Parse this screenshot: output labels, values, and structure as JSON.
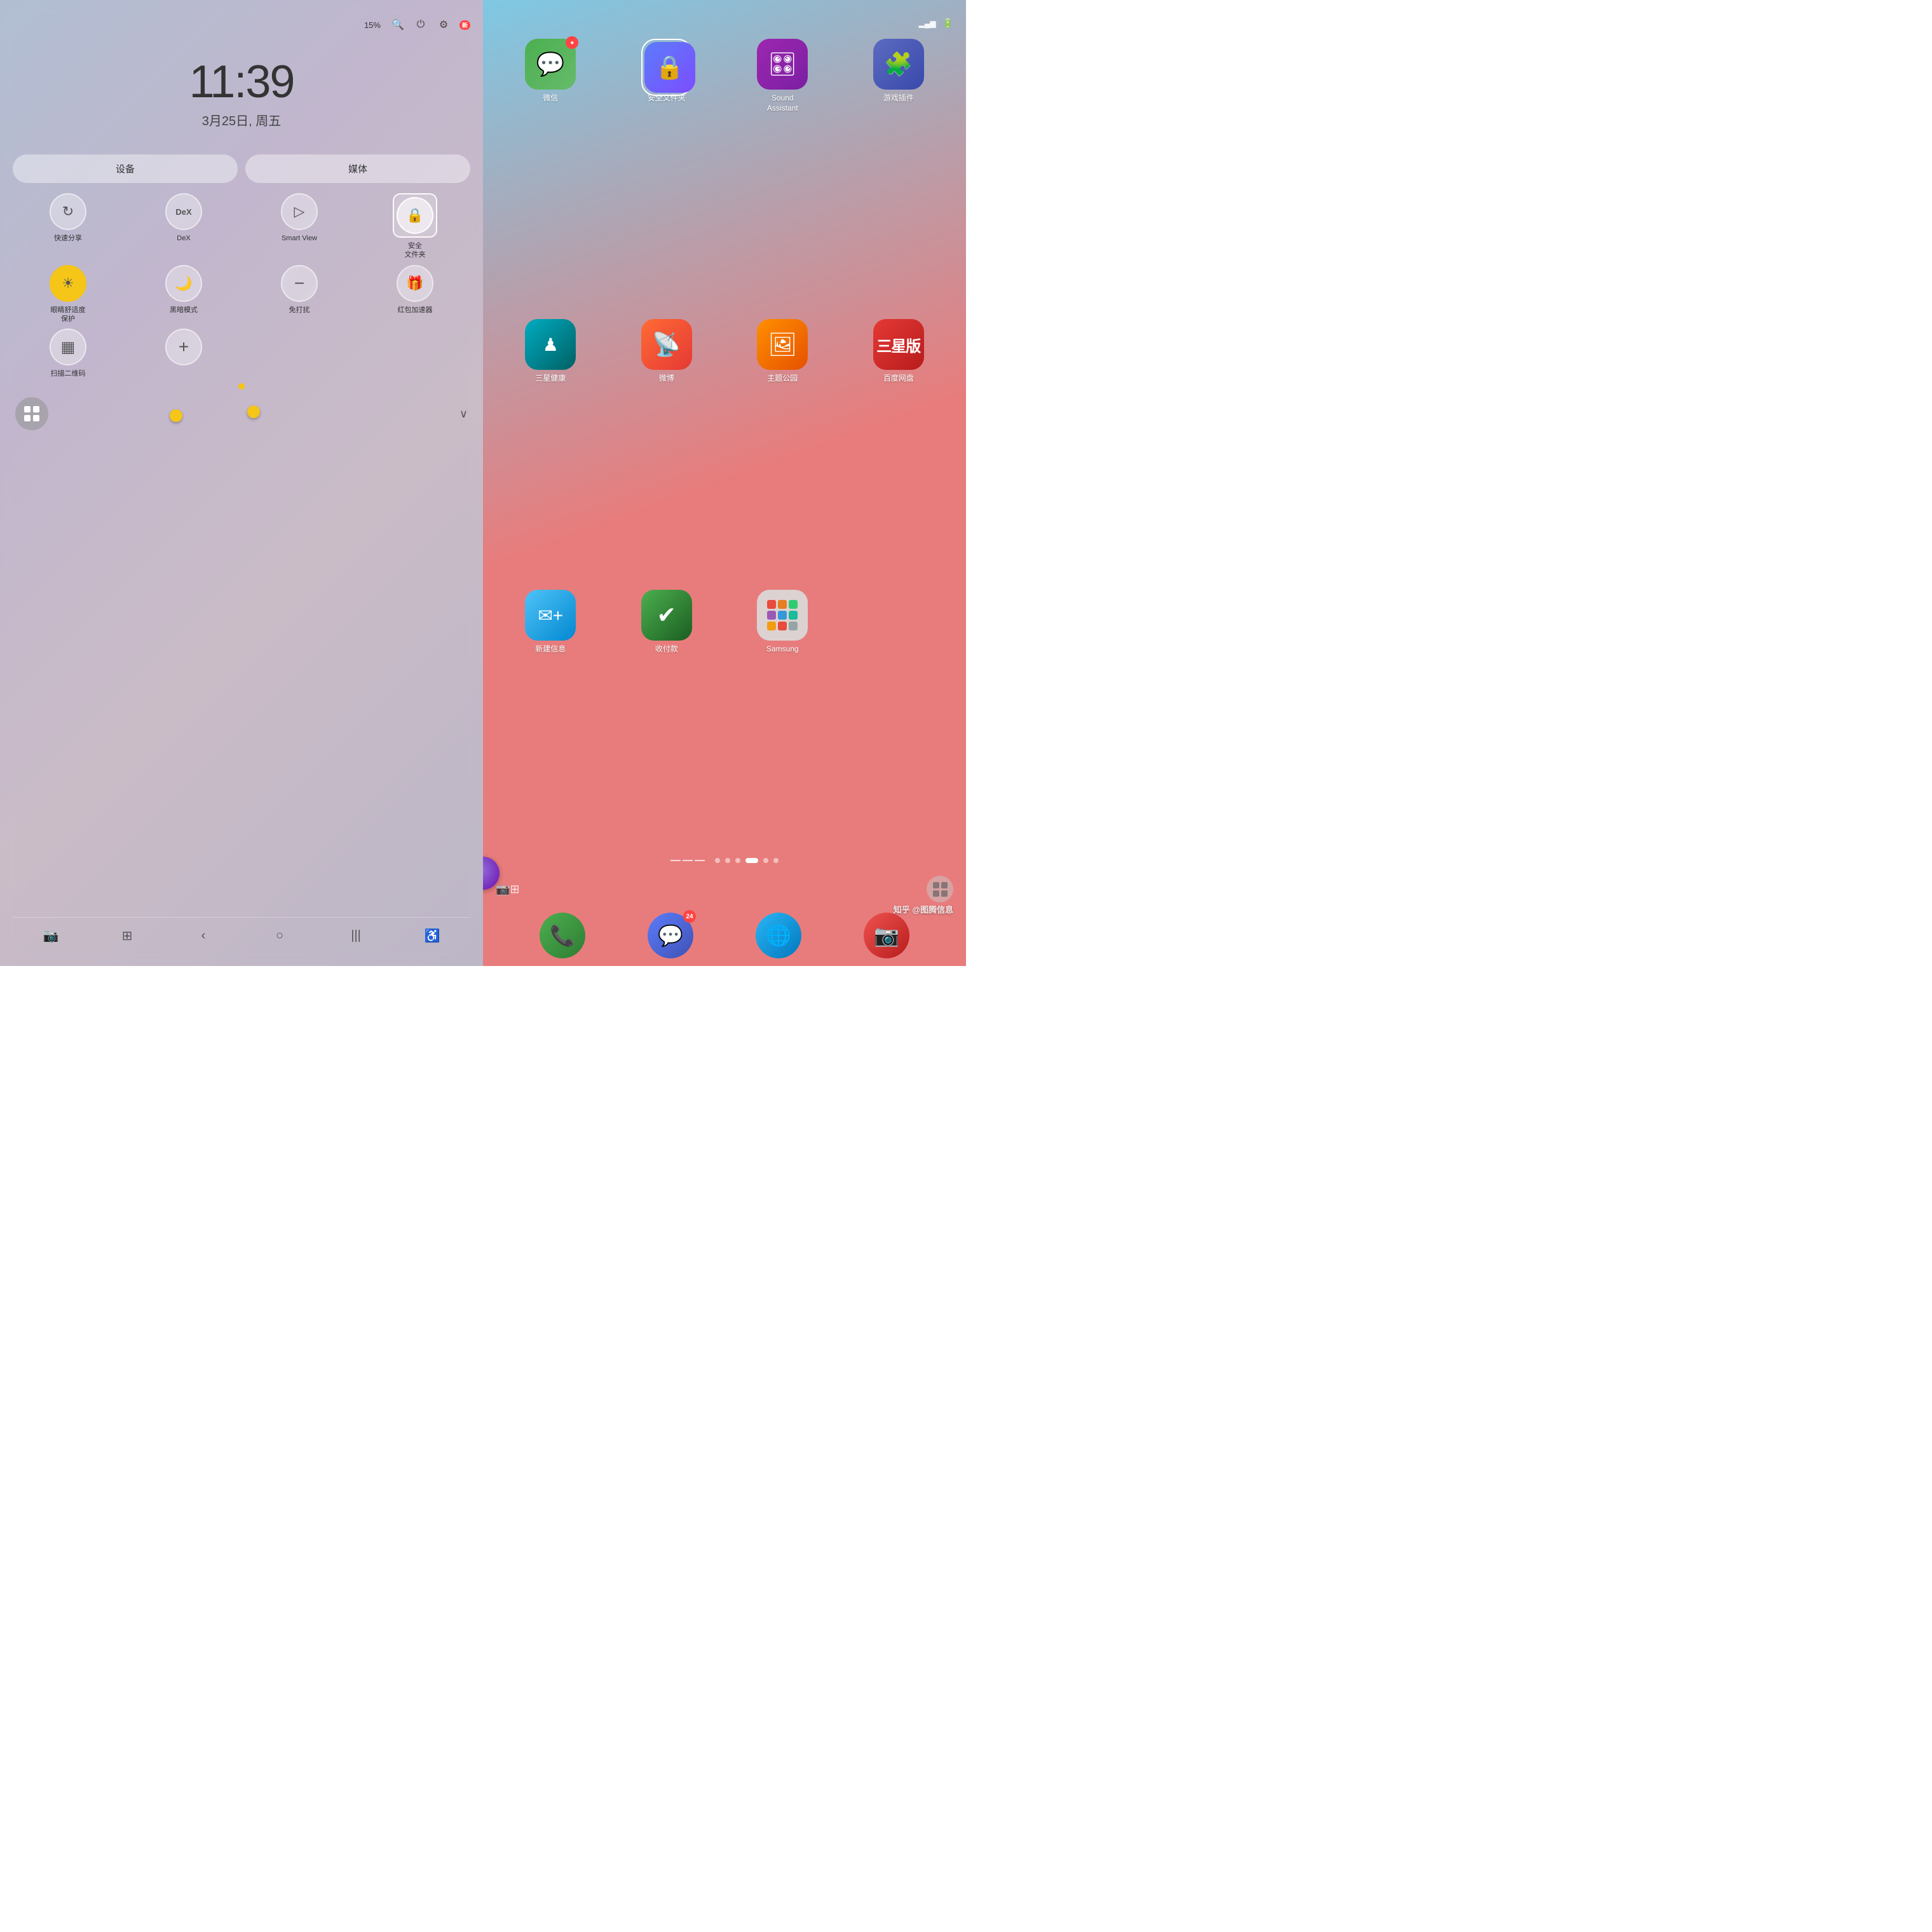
{
  "left": {
    "battery": "15%",
    "clock_time": "11:39",
    "clock_date": "3月25日, 周五",
    "tab_device": "设备",
    "tab_media": "媒体",
    "toggles_row1": [
      {
        "id": "quick-share",
        "label": "快速分享",
        "icon": "↻",
        "style": "normal"
      },
      {
        "id": "dex",
        "label": "DeX",
        "icon": "DeX",
        "style": "normal"
      },
      {
        "id": "smart-view",
        "label": "Smart View",
        "icon": "▷",
        "style": "normal"
      },
      {
        "id": "secure-folder",
        "label": "安全\n文件夹",
        "icon": "🔒",
        "style": "highlighted"
      }
    ],
    "toggles_row2": [
      {
        "id": "eye-comfort",
        "label": "眼睛舒适度\n保护",
        "icon": "☀",
        "style": "yellow"
      },
      {
        "id": "dark-mode",
        "label": "黑暗模式",
        "icon": "🌙",
        "style": "normal"
      },
      {
        "id": "dnd",
        "label": "免打扰",
        "icon": "−",
        "style": "normal"
      },
      {
        "id": "red-envelope",
        "label": "红包加速器",
        "icon": "🎁",
        "style": "normal"
      }
    ],
    "toggles_row3": [
      {
        "id": "qr-code",
        "label": "扫描二维码",
        "icon": "QR",
        "style": "normal"
      },
      {
        "id": "add",
        "label": "",
        "icon": "+",
        "style": "normal"
      }
    ],
    "status_icons": [
      "🔍",
      "⏻",
      "⚙",
      "新"
    ]
  },
  "right": {
    "apps_row1": [
      {
        "id": "wechat",
        "label": "微信",
        "color": "wechat",
        "icon": "💬",
        "badge": ""
      },
      {
        "id": "secure-folder",
        "label": "安全文件夹",
        "color": "secure",
        "icon": "🔒",
        "badge": "",
        "selected": true
      },
      {
        "id": "sound-assistant",
        "label": "Sound\nAssistant",
        "color": "sound",
        "icon": "🎛",
        "badge": ""
      },
      {
        "id": "game-plugin",
        "label": "游戏插件",
        "color": "game",
        "icon": "🧩",
        "badge": ""
      }
    ],
    "apps_row2": [
      {
        "id": "samsung-health",
        "label": "三星健康",
        "color": "health",
        "icon": "♟",
        "badge": ""
      },
      {
        "id": "weibo",
        "label": "微博",
        "color": "weibo",
        "icon": "📡",
        "badge": ""
      },
      {
        "id": "theme-park",
        "label": "主题公园",
        "color": "theme",
        "icon": "🖼",
        "badge": ""
      },
      {
        "id": "baidu-disk",
        "label": "百度网盘",
        "color": "baidu",
        "icon": "☁",
        "badge": ""
      }
    ],
    "apps_row3": [
      {
        "id": "new-message",
        "label": "新建信息",
        "color": "new-msg",
        "icon": "+",
        "badge": ""
      },
      {
        "id": "payment",
        "label": "收付款",
        "color": "payment",
        "icon": "✔",
        "badge": ""
      },
      {
        "id": "samsung-folder",
        "label": "Samsung",
        "color": "samsung-folder",
        "icon": "",
        "badge": ""
      }
    ],
    "page_dots": [
      "inactive",
      "inactive",
      "inactive",
      "active",
      "inactive",
      "inactive"
    ],
    "dock": [
      {
        "id": "phone",
        "label": "",
        "color": "phone",
        "icon": "📞"
      },
      {
        "id": "messages",
        "label": "",
        "color": "msg",
        "icon": "💬",
        "badge": "24"
      },
      {
        "id": "browser",
        "label": "",
        "color": "browser",
        "icon": "🌐"
      },
      {
        "id": "screenshot",
        "label": "",
        "color": "camera",
        "icon": "📷"
      }
    ],
    "watermark": "知乎 @图腾信息"
  }
}
